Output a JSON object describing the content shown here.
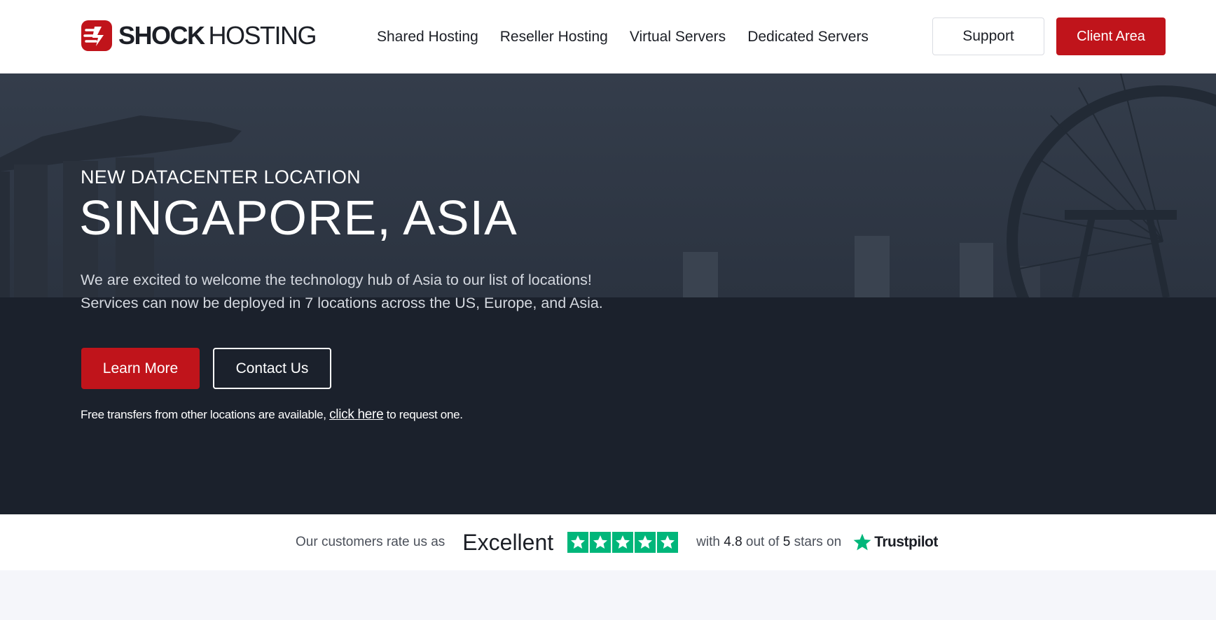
{
  "brand": {
    "name_bold": "SHOCK",
    "name_light": "HOSTING",
    "accent": "#c0141b"
  },
  "nav": {
    "links": [
      "Shared Hosting",
      "Reseller Hosting",
      "Virtual Servers",
      "Dedicated Servers"
    ],
    "support_label": "Support",
    "client_area_label": "Client Area"
  },
  "hero": {
    "eyebrow": "NEW DATACENTER LOCATION",
    "headline": "SINGAPORE, ASIA",
    "description_line1": "We are excited to welcome the technology hub of Asia to our list of locations!",
    "description_line2": "Services can now be deployed in 7 locations across the US, Europe, and Asia.",
    "learn_more_label": "Learn More",
    "contact_label": "Contact Us",
    "transfer_prefix": "Free transfers from other locations are available, ",
    "transfer_link": "click here",
    "transfer_suffix": " to request one.",
    "background": "#1b212c"
  },
  "trust": {
    "lead": "Our customers rate us as",
    "rating_word": "Excellent",
    "stars": 5,
    "with": "with",
    "score": "4.8",
    "out_of": "out of",
    "max": "5",
    "stars_on": "stars on",
    "provider": "Trustpilot",
    "star_color": "#00b67a"
  }
}
